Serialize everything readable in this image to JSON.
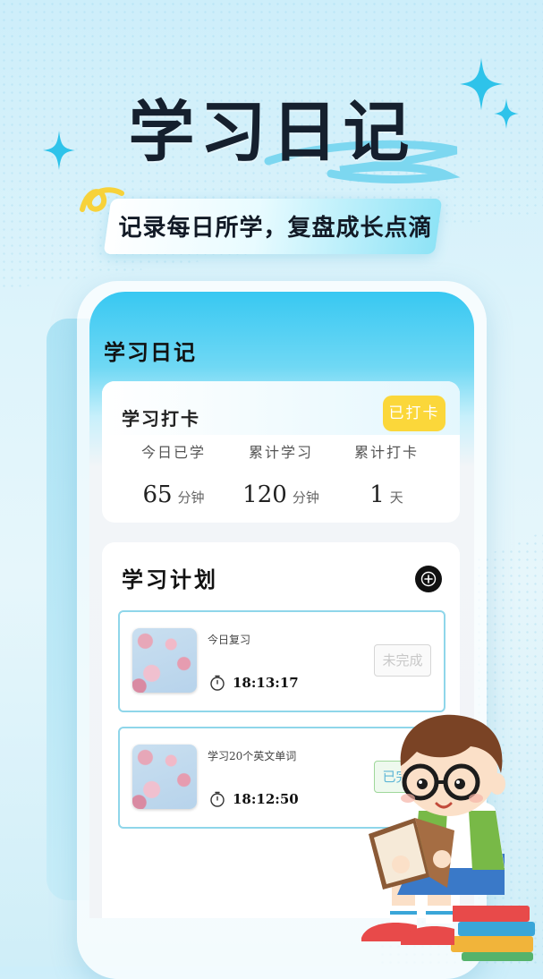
{
  "hero": {
    "title": "学习日记",
    "subtitle": "记录每日所学，复盘成长点滴"
  },
  "app": {
    "screen_title": "学习日记",
    "checkin": {
      "title": "学习打卡",
      "button_label": "已打卡",
      "stats": [
        {
          "label": "今日已学",
          "value": "65",
          "unit": "分钟"
        },
        {
          "label": "累计学习",
          "value": "120",
          "unit": "分钟"
        },
        {
          "label": "累计打卡",
          "value": "1",
          "unit": "天"
        }
      ]
    },
    "plan": {
      "title": "学习计划",
      "tasks": [
        {
          "name": "今日复习",
          "time": "18:13:17",
          "status": "未完成"
        },
        {
          "name": "学习20个英文单词",
          "time": "18:12:50",
          "status": "已完成"
        }
      ]
    }
  },
  "colors": {
    "accent": "#38c8f2",
    "checked_button": "#fbd73a",
    "task_border": "#8fd6ea"
  },
  "icons": [
    "sparkle-icon",
    "ribbon-icon",
    "add-icon",
    "clock-icon",
    "cherry-blossom-thumbnail",
    "boy-reading-illustration"
  ]
}
